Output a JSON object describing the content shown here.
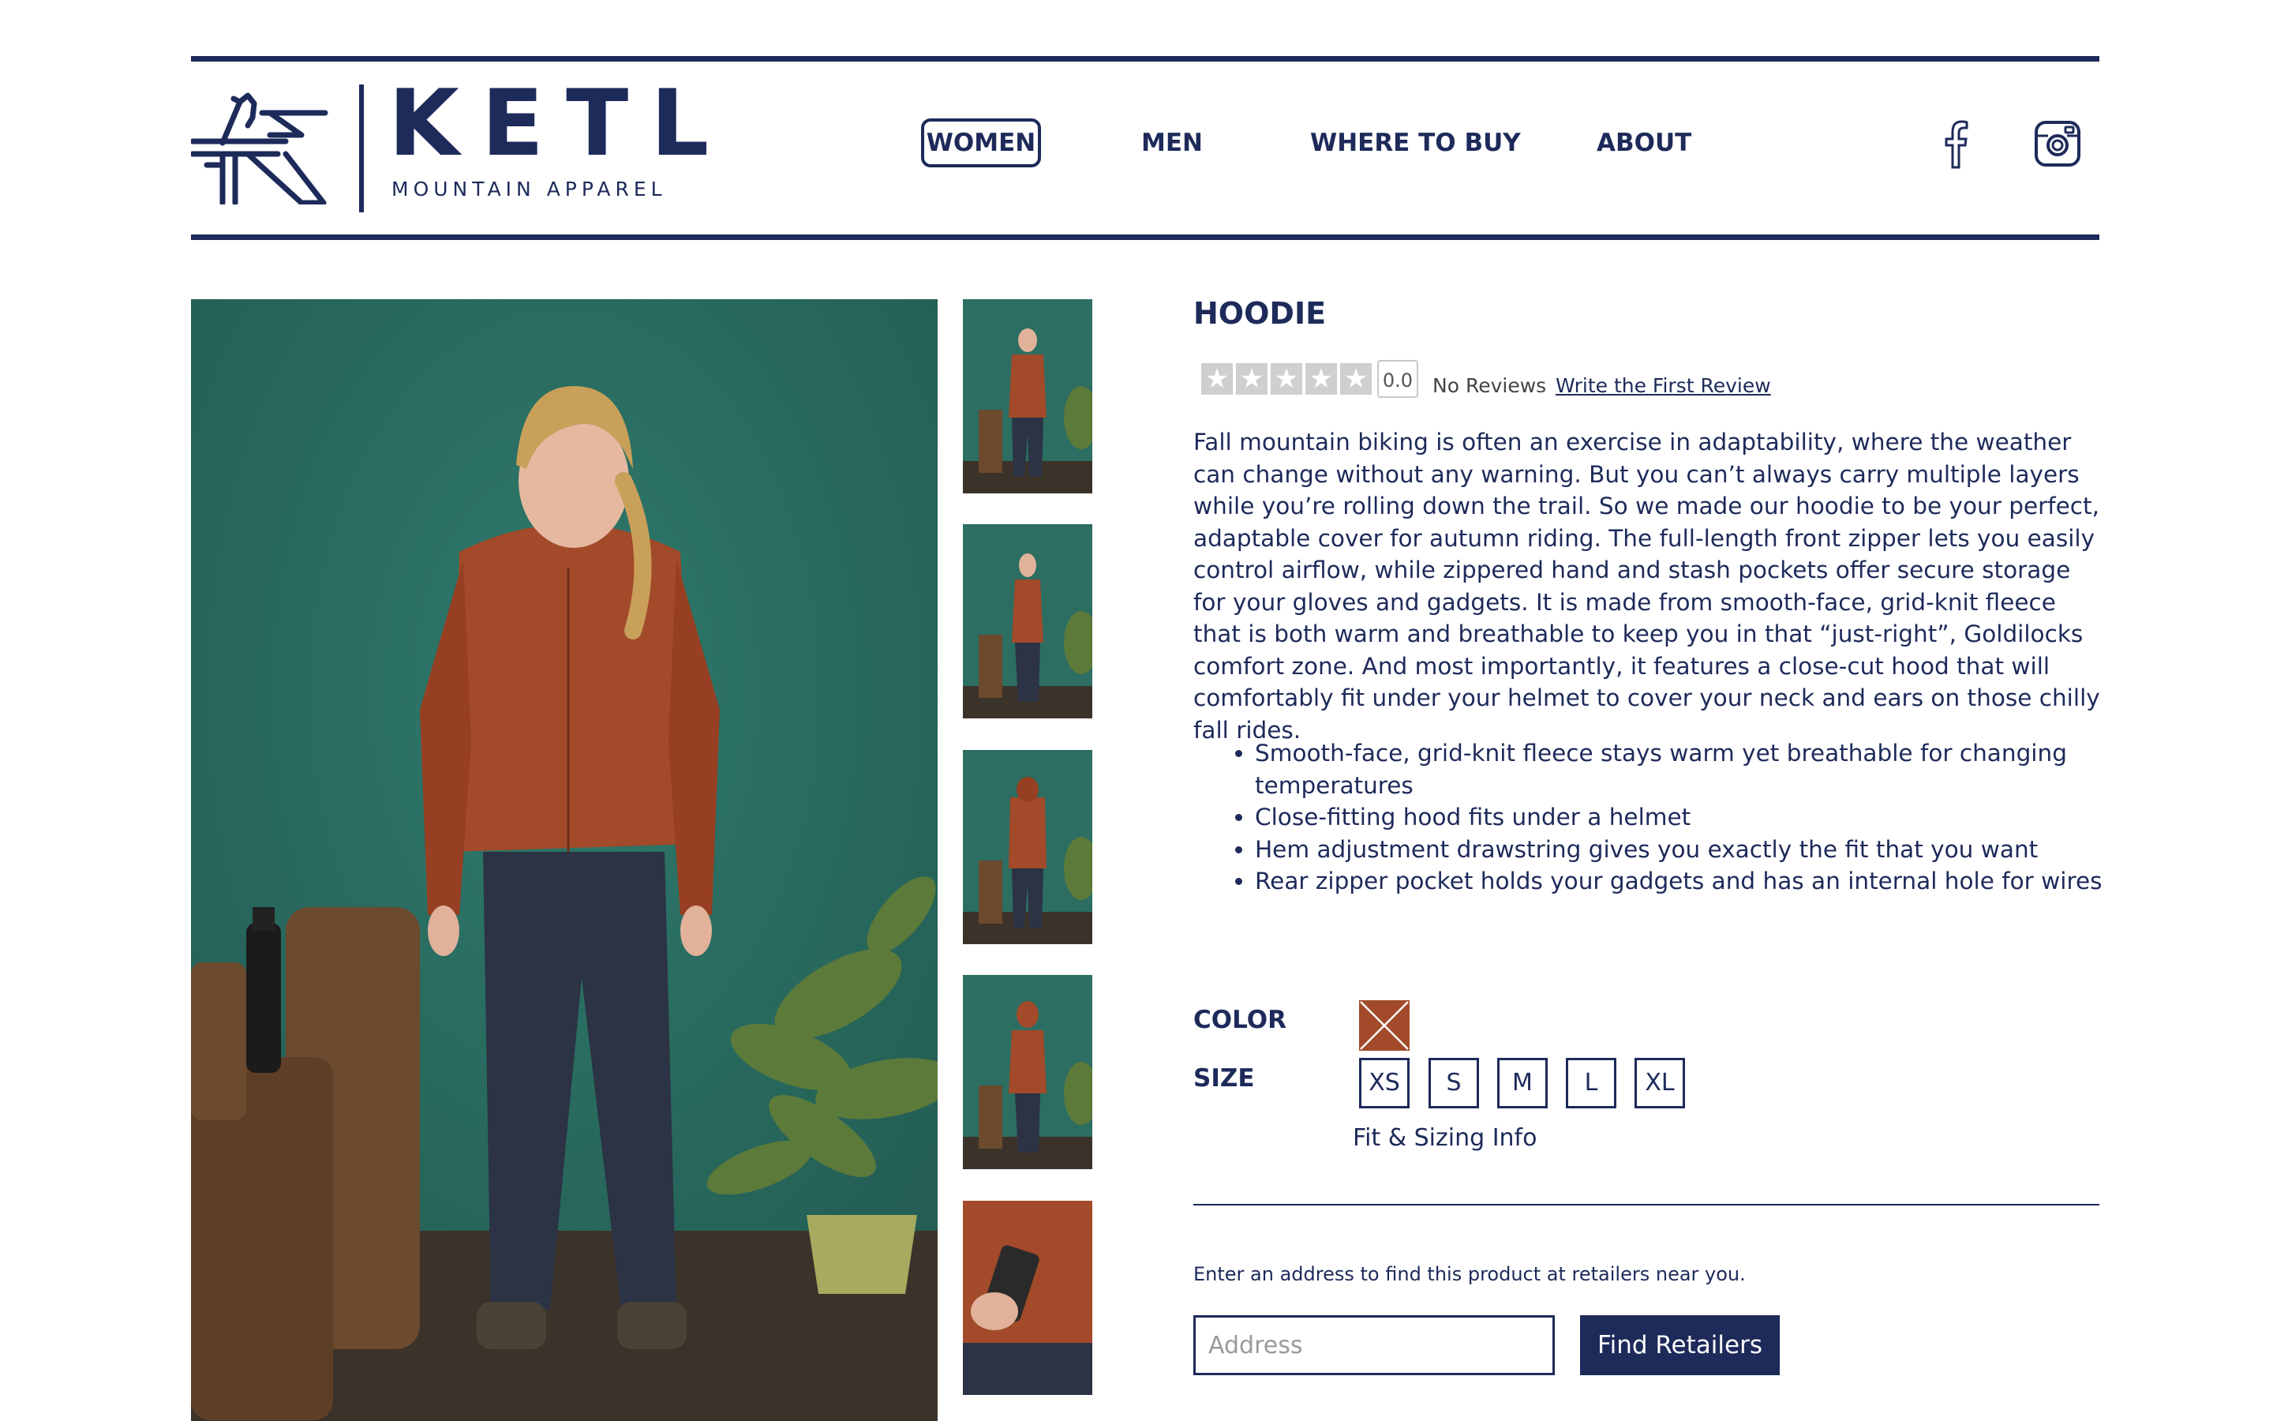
{
  "header": {
    "brand_name": "KETL",
    "brand_tagline": "MOUNTAIN APPAREL",
    "nav": [
      {
        "label": "WOMEN",
        "active": true
      },
      {
        "label": "MEN",
        "active": false
      },
      {
        "label": "WHERE TO BUY",
        "active": false
      },
      {
        "label": "ABOUT",
        "active": false
      }
    ],
    "social_icons": [
      "facebook-icon",
      "instagram-icon"
    ]
  },
  "gallery": {
    "main_image": "woman wearing orange hoodie and dark pants on teal backdrop",
    "thumbnail_count": 5
  },
  "product": {
    "title": "HOODIE",
    "rating": {
      "stars_filled": 0,
      "stars_total": 5,
      "score": "0.0",
      "reviews_label": "No Reviews",
      "write_review_label": "Write the First Review"
    },
    "description": "Fall mountain biking is often an exercise in adaptability, where the weather can change without any warning. But you can’t always carry multiple layers while you’re rolling down the trail. So we made our hoodie to be your perfect, adaptable cover for autumn riding. The full-length front zipper lets you easily control airflow, while zippered hand and stash pockets offer secure storage for your gloves and gadgets. It is made from smooth-face, grid-knit fleece that is both warm and breathable to keep you in that “just-right”, Goldilocks comfort zone. And most importantly, it features a close-cut hood that will comfortably fit under your helmet to cover your neck and ears on those chilly fall rides.",
    "features": [
      "Smooth-face, grid-knit fleece stays warm yet breathable for changing temperatures",
      "Close-fitting hood fits under a helmet",
      "Hem adjustment drawstring gives you exactly the fit that you want",
      "Rear zipper pocket holds your gadgets and has an internal hole for wires"
    ],
    "color_label": "COLOR",
    "color_swatch": "#a24a2a",
    "size_label": "SIZE",
    "sizes": [
      "XS",
      "S",
      "M",
      "L",
      "XL"
    ],
    "fit_info_label": "Fit & Sizing Info"
  },
  "retailers": {
    "hint": "Enter an address to find this product at retailers near you.",
    "address_placeholder": "Address",
    "button_label": "Find Retailers"
  },
  "colors": {
    "brand": "#1d2a5a",
    "backdrop": "#2f6d62",
    "hoodie": "#a24a2a"
  }
}
